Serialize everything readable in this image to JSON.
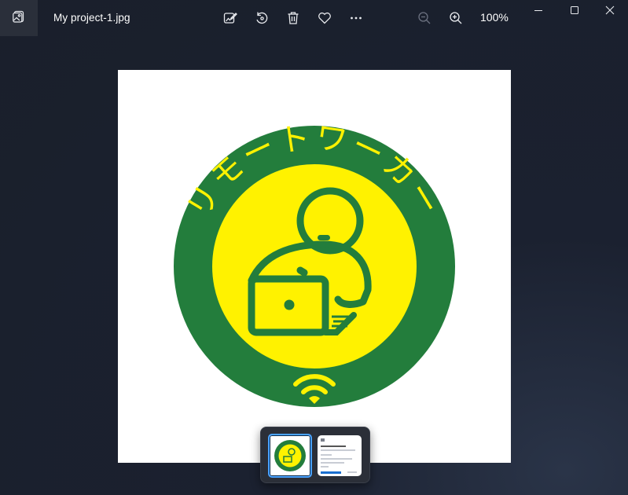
{
  "window": {
    "title": "My project-1.jpg",
    "zoom_label": "100%"
  },
  "toolbar": {
    "app_icon": "gallery-icon",
    "tools": [
      "edit-image-icon",
      "rotate-icon",
      "delete-icon",
      "favorite-icon",
      "more-icon"
    ],
    "zoom_out": "zoom-out-icon",
    "zoom_in": "zoom-in-icon"
  },
  "image": {
    "logo_text": "リモートワーカー",
    "colors": {
      "ring": "#237d3c",
      "fill": "#fff200",
      "background": "#ffffff"
    }
  },
  "filmstrip": {
    "thumbnails": [
      "My project-1.jpg",
      "document-thumbnail"
    ],
    "selected_index": 0,
    "accent": "#4aa3ff"
  }
}
